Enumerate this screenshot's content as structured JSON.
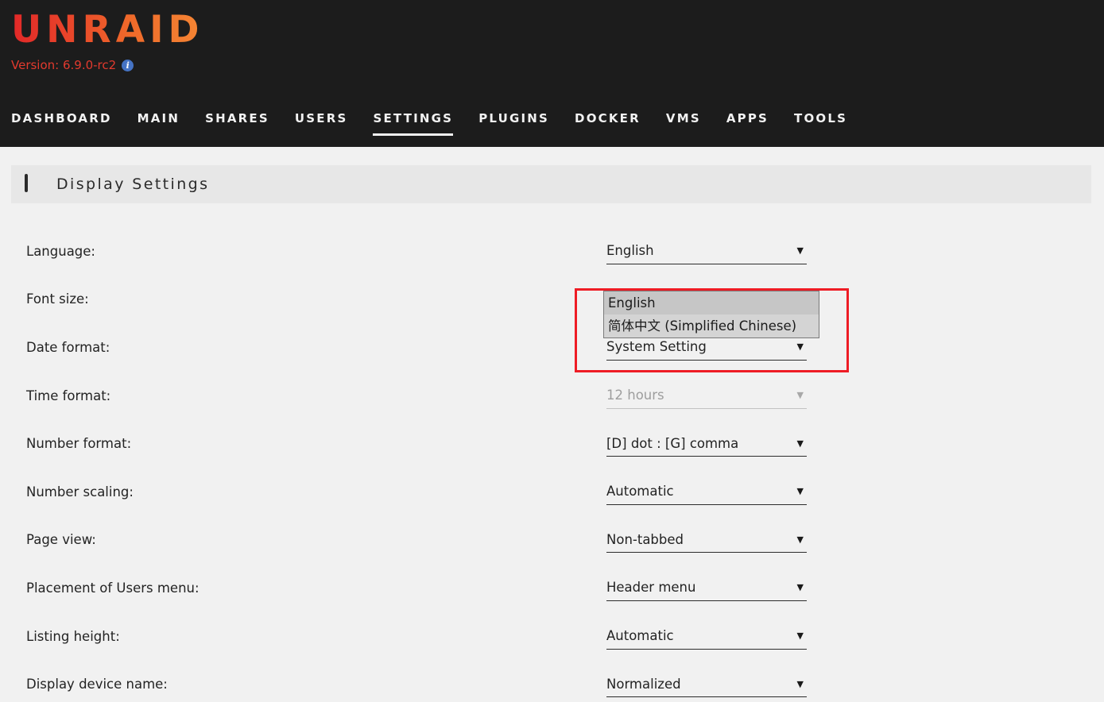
{
  "header": {
    "logo_text": "UNRAID",
    "version_label": "Version: 6.9.0-rc2",
    "info_icon_glyph": "i",
    "brand_gradient_start": "#e22828",
    "brand_gradient_end": "#f58634",
    "version_color": "#e23a2e",
    "info_icon_color": "#4573c4",
    "background_color": "#1c1c1c"
  },
  "nav": {
    "items": [
      {
        "label": "DASHBOARD",
        "active": false
      },
      {
        "label": "MAIN",
        "active": false
      },
      {
        "label": "SHARES",
        "active": false
      },
      {
        "label": "USERS",
        "active": false
      },
      {
        "label": "SETTINGS",
        "active": true
      },
      {
        "label": "PLUGINS",
        "active": false
      },
      {
        "label": "DOCKER",
        "active": false
      },
      {
        "label": "VMS",
        "active": false
      },
      {
        "label": "APPS",
        "active": false
      },
      {
        "label": "TOOLS",
        "active": false
      }
    ]
  },
  "page": {
    "title": "Display Settings",
    "icon": "monitor-icon",
    "header_bg": "#e7e7e7",
    "body_bg": "#f1f1f1"
  },
  "settings": {
    "rows": [
      {
        "label": "Language:",
        "value": "English",
        "disabled": false
      },
      {
        "label": "Font size:",
        "value": "",
        "disabled": false
      },
      {
        "label": "Date format:",
        "value": "System Setting",
        "disabled": false
      },
      {
        "label": "Time format:",
        "value": "12 hours",
        "disabled": true
      },
      {
        "label": "Number format:",
        "value": "[D] dot : [G] comma",
        "disabled": false
      },
      {
        "label": "Number scaling:",
        "value": "Automatic",
        "disabled": false
      },
      {
        "label": "Page view:",
        "value": "Non-tabbed",
        "disabled": false
      },
      {
        "label": "Placement of Users menu:",
        "value": "Header menu",
        "disabled": false
      },
      {
        "label": "Listing height:",
        "value": "Automatic",
        "disabled": false
      },
      {
        "label": "Display device name:",
        "value": "Normalized",
        "disabled": false
      }
    ],
    "caret_glyph": "▼"
  },
  "language_dropdown": {
    "open": true,
    "options": [
      {
        "label": "English",
        "selected": true
      },
      {
        "label": "简体中文 (Simplified Chinese)",
        "selected": false
      }
    ],
    "list_bg": "#d4d4d4",
    "selected_bg": "#c6c6c6"
  },
  "annotation": {
    "shape": "rectangle",
    "color": "#ee1c25"
  }
}
